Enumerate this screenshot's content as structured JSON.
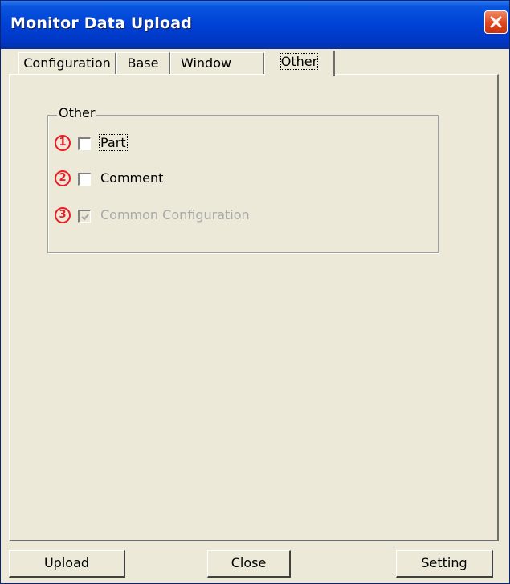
{
  "window": {
    "title": "Monitor Data Upload"
  },
  "tabs": [
    {
      "label": "Configuration",
      "active": false
    },
    {
      "label": "Base",
      "active": false
    },
    {
      "label": "Window",
      "active": false
    },
    {
      "label": "Other",
      "active": true
    }
  ],
  "group": {
    "label": "Other",
    "options": [
      {
        "number": "1",
        "label": "Part",
        "checked": false,
        "disabled": false,
        "focused": true
      },
      {
        "number": "2",
        "label": "Comment",
        "checked": false,
        "disabled": false,
        "focused": false
      },
      {
        "number": "3",
        "label": "Common Configuration",
        "checked": true,
        "disabled": true,
        "focused": false
      }
    ]
  },
  "buttons": {
    "upload": "Upload",
    "close": "Close",
    "setting": "Setting"
  },
  "colors": {
    "titlebar": "#0041d6",
    "annotation": "#ee1c24",
    "disabled_text": "#a9a9a9",
    "dialog_bg": "#ece9d8"
  }
}
